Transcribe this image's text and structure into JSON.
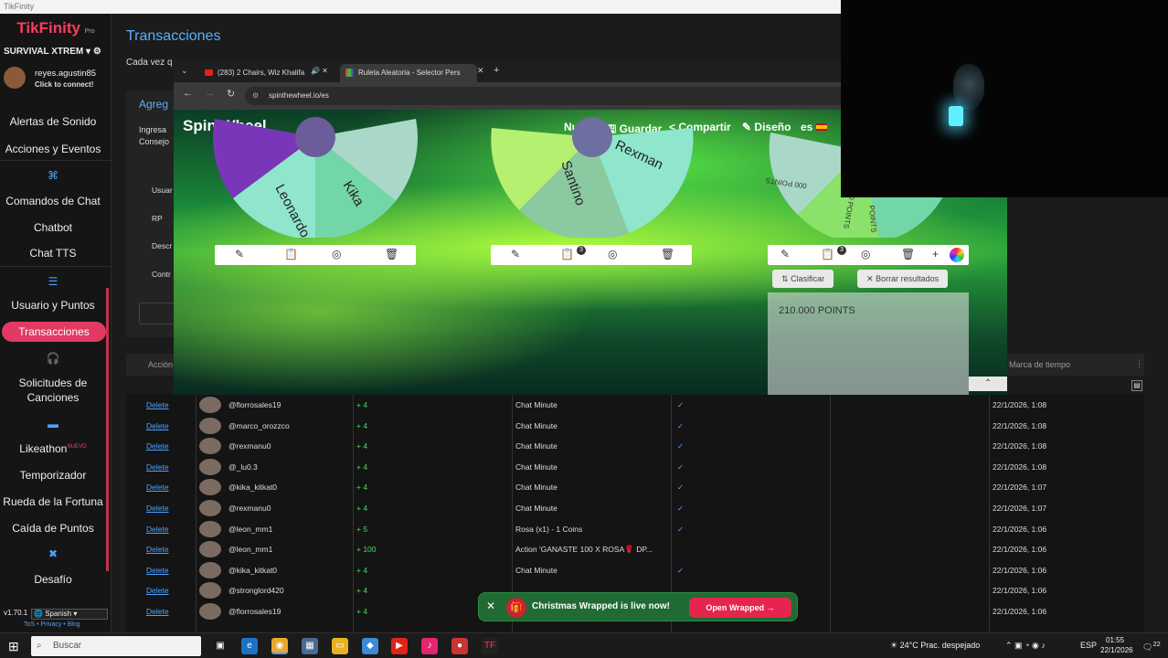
{
  "window_title": "TikFinity",
  "sidebar": {
    "logo": "TikFinity",
    "logo_sub": "Pro",
    "profile": "SURVIVAL XTREM",
    "user_name": "reyes.agustin85",
    "user_sub": "Click to connect!",
    "items": [
      {
        "label": "Alertas de Sonido"
      },
      {
        "label": "Acciones y Eventos"
      },
      {
        "label": "Comandos de Chat"
      },
      {
        "label": "Chatbot"
      },
      {
        "label": "Chat TTS"
      },
      {
        "label": "Usuario y Puntos"
      },
      {
        "label": "Transacciones"
      },
      {
        "label": "Solicitudes de"
      },
      {
        "label": "Canciones"
      },
      {
        "label": "Likeathon"
      },
      {
        "label": "Temporizador"
      },
      {
        "label": "Rueda de la Fortuna"
      },
      {
        "label": "Caída de Puntos"
      },
      {
        "label": "Desafío"
      }
    ],
    "likeathon_badge": "NUEVO",
    "version": "v1.70.1",
    "language": "Spanish",
    "legal": "ToS • Privacy • Blog"
  },
  "main": {
    "title": "Transacciones",
    "desc": "Cada vez q",
    "card_heading": "Agreg",
    "card_lines": [
      "Ingresa",
      "Consejo"
    ],
    "card_fields": [
      "Usuar",
      "RP",
      "Descr",
      "Contr"
    ],
    "col_action": "Acción",
    "col_time": "Marca de tiempo",
    "rows": [
      {
        "action": "Delete",
        "user": "@florrosales19",
        "amount": "+ 4",
        "type": "Chat Minute",
        "check": "✓",
        "date": "22/1/2026, 1:08"
      },
      {
        "action": "Delete",
        "user": "@marco_orozzco",
        "amount": "+ 4",
        "type": "Chat Minute",
        "check": "✓",
        "date": "22/1/2026, 1:08"
      },
      {
        "action": "Delete",
        "user": "@rexmanu0",
        "amount": "+ 4",
        "type": "Chat Minute",
        "check": "✓",
        "date": "22/1/2026, 1:08"
      },
      {
        "action": "Delete",
        "user": "@_lu0.3",
        "amount": "+ 4",
        "type": "Chat Minute",
        "check": "✓",
        "date": "22/1/2026, 1:08"
      },
      {
        "action": "Delete",
        "user": "@kika_kitkat0",
        "amount": "+ 4",
        "type": "Chat Minute",
        "check": "✓",
        "date": "22/1/2026, 1:07"
      },
      {
        "action": "Delete",
        "user": "@rexmanu0",
        "amount": "+ 4",
        "type": "Chat Minute",
        "check": "✓",
        "date": "22/1/2026, 1:07"
      },
      {
        "action": "Delete",
        "user": "@leon_mm1",
        "amount": "+ 5",
        "type": "Rosa (x1) - 1 Coins",
        "check": "✓",
        "date": "22/1/2026, 1:06"
      },
      {
        "action": "Delete",
        "user": "@leon_mm1",
        "amount": "+ 100",
        "type": "Action 'GANASTE 100 X ROSA🌹 DP...",
        "check": "",
        "date": "22/1/2026, 1:06"
      },
      {
        "action": "Delete",
        "user": "@kika_kitkat0",
        "amount": "+ 4",
        "type": "Chat Minute",
        "check": "✓",
        "date": "22/1/2026, 1:06"
      },
      {
        "action": "Delete",
        "user": "@stronglord420",
        "amount": "+ 4",
        "type": "",
        "check": "",
        "date": "22/1/2026, 1:06"
      },
      {
        "action": "Delete",
        "user": "@florrosales19",
        "amount": "+ 4",
        "type": "",
        "check": "",
        "date": "22/1/2026, 1:06"
      }
    ]
  },
  "browser": {
    "tabs": [
      {
        "label": "(283) 2 Chairs, Wiz Khalifa"
      },
      {
        "label": "Ruleta Aleatoria - Selector Pers"
      }
    ],
    "url": "spinthewheel.io/es",
    "site_title": "Spin Wheel",
    "menu": [
      "Nuevo",
      "Guardar",
      "Compartir",
      "Diseño",
      "es"
    ],
    "wheel1": [
      "Leonardo",
      "Kika"
    ],
    "wheel2": [
      "Santino",
      "Rexman"
    ],
    "wheel3": [
      "000 POINTS",
      "000 POINTS",
      "POINTS"
    ],
    "badge_count": "3",
    "btn_sort": "Clasificar",
    "btn_clear": "Borrar resultados",
    "result": "210.000 POINTS"
  },
  "toast": {
    "message": "Christmas Wrapped is live now!",
    "cta": "Open Wrapped",
    "accent": "#e5254d"
  },
  "taskbar": {
    "search": "Buscar",
    "weather": "24°C  Prac. despejado",
    "lang": "ESP",
    "time": "01:55",
    "date": "22/1/2026",
    "notif": "22"
  },
  "colors": {
    "accent": "#e23a63",
    "link": "#4aa3ff",
    "positive": "#4cd964"
  }
}
